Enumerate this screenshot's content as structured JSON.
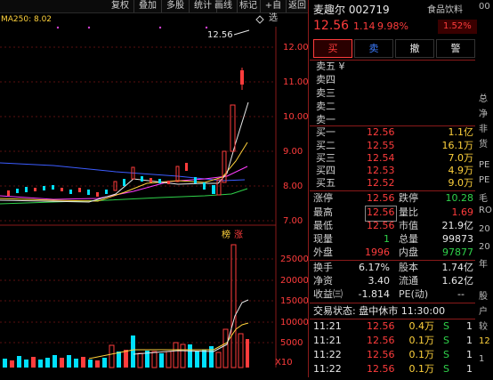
{
  "toolbar": {
    "items": [
      "复权",
      "叠加",
      "多股",
      "统计",
      "画线",
      "标记",
      "+自选",
      "返回"
    ],
    "left_label": "MA250: 8.02"
  },
  "chart": {
    "price_labels": [
      "12.00",
      "11.00",
      "10.00",
      "9.00",
      "8.00",
      "7.00"
    ],
    "volume_labels": [
      "25000",
      "20000",
      "15000",
      "10000",
      "5000"
    ],
    "volume_unit": "X10",
    "high_marker": "12.56",
    "tag_left": "榜",
    "tag_right": "涨",
    "colors": {
      "up": "#ff3c3c",
      "down": "#00e0ff",
      "ma5": "#ffffff",
      "ma10": "#ffd23c",
      "ma20": "#ff3cff",
      "ma60": "#2fd24a",
      "ma250": "#3c5cff"
    }
  },
  "stock": {
    "name": "麦趣尔",
    "code": "002719",
    "price": "12.56",
    "change": "1.14",
    "change_pct": "9.98%",
    "sector": "食品饮料",
    "sector_pct": "1.52%"
  },
  "buttons": [
    "买",
    "卖",
    "撤",
    "警"
  ],
  "sell_levels": [
    "卖五 ¥",
    "卖四",
    "卖三",
    "卖二",
    "卖一"
  ],
  "buy_levels": [
    {
      "label": "买一",
      "price": "12.56",
      "vol": "1.1亿"
    },
    {
      "label": "买二",
      "price": "12.55",
      "vol": "16.1万"
    },
    {
      "label": "买三",
      "price": "12.54",
      "vol": "7.0万"
    },
    {
      "label": "买四",
      "price": "12.53",
      "vol": "4.9万"
    },
    {
      "label": "买五",
      "price": "12.52",
      "vol": "9.0万"
    }
  ],
  "stats": {
    "zhangting_l": "涨停",
    "zhangting_v": "12.56",
    "dieting_l": "跌停",
    "dieting_v": "10.28",
    "zuigao_l": "最高",
    "zuigao_v": "12.56",
    "liangbi_l": "量比",
    "liangbi_v": "1.69",
    "zuidi_l": "最低",
    "zuidi_v": "12.56",
    "shizhi_l": "市值",
    "shizhi_v": "21.9亿",
    "xianliang_l": "现量",
    "xianliang_v": "1",
    "zongliang_l": "总量",
    "zongliang_v": "99873",
    "waipan_l": "外盘",
    "waipan_v": "1996",
    "neipan_l": "内盘",
    "neipan_v": "97877",
    "huanshou_l": "换手",
    "huanshou_v": "6.17%",
    "guben_l": "股本",
    "guben_v": "1.74亿",
    "jingzi_l": "净资",
    "jingzi_v": "3.40",
    "liutong_l": "流通",
    "liutong_v": "1.62亿",
    "shouyi_l": "收益㈢",
    "shouyi_v": "-1.814",
    "pe_l": "PE(动)",
    "pe_v": "--"
  },
  "status": "交易状态: 盘中休市 11:30:00",
  "trades": [
    {
      "time": "11:21",
      "price": "12.56",
      "vol": "0.4万",
      "side": "S",
      "n": "1"
    },
    {
      "time": "11:21",
      "price": "12.56",
      "vol": "0.1万",
      "side": "S",
      "n": "1"
    },
    {
      "time": "11:22",
      "price": "12.56",
      "vol": "0.1万",
      "side": "S",
      "n": "1"
    },
    {
      "time": "11:22",
      "price": "12.56",
      "vol": "0.1万",
      "side": "S",
      "n": "1"
    }
  ],
  "edge_texts": [
    "00",
    "总",
    "净",
    "非",
    "货",
    "PE",
    "PE",
    "毛",
    "RO",
    "20",
    "20",
    "年",
    "股",
    "户",
    "较",
    "12",
    "1"
  ]
}
